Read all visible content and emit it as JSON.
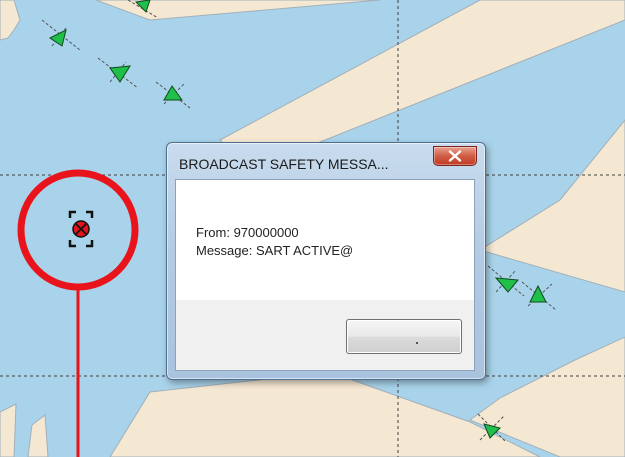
{
  "dialog": {
    "title": "BROADCAST SAFETY MESSA...",
    "close_icon": "close-x-icon",
    "from_label": "From:",
    "from_value": "970000000",
    "message_label": "Message:",
    "message_value": "SART ACTIVE@",
    "ok_button_label": ""
  },
  "map": {
    "sart_icon": "sart-target-icon",
    "vessel_icon": "ais-vessel-triangle-icon",
    "highlight_icon": "red-circle-callout-icon"
  },
  "colors": {
    "water": "#a9d3ea",
    "land": "#f5e8d3",
    "vessel_fill": "#1fbf4a",
    "highlight_red": "#e8131b",
    "sart_red": "#e0141a",
    "dialog_frame": "#b3cbe3",
    "close_button": "#c9472e"
  }
}
